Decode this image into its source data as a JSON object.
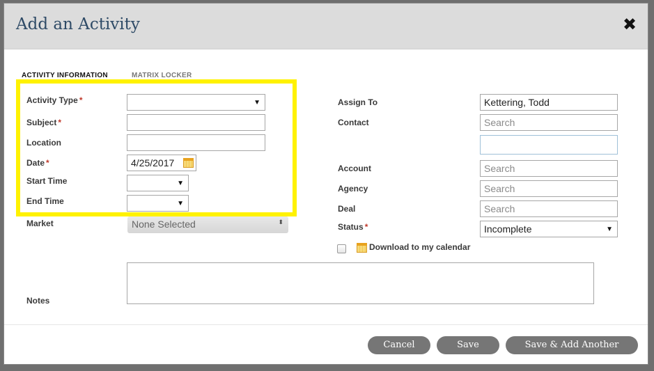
{
  "modal": {
    "title": "Add an Activity",
    "close_icon": "✖"
  },
  "tabs": [
    {
      "label": "ACTIVITY INFORMATION",
      "active": true
    },
    {
      "label": "MATRIX LOCKER",
      "active": false
    }
  ],
  "left_form": {
    "activity_type": {
      "label": "Activity Type",
      "required_mark": "*",
      "value": ""
    },
    "subject": {
      "label": "Subject",
      "required_mark": "*",
      "value": ""
    },
    "location": {
      "label": "Location",
      "value": ""
    },
    "date": {
      "label": "Date",
      "required_mark": "*",
      "value": "4/25/2017"
    },
    "start_time": {
      "label": "Start Time",
      "value": ""
    },
    "end_time": {
      "label": "End Time",
      "value": ""
    },
    "market": {
      "label": "Market",
      "value": "None Selected"
    }
  },
  "right_form": {
    "assign_to": {
      "label": "Assign To",
      "value": "Kettering, Todd"
    },
    "contact": {
      "label": "Contact",
      "placeholder": "Search"
    },
    "account": {
      "label": "Account",
      "placeholder": "Search"
    },
    "agency": {
      "label": "Agency",
      "placeholder": "Search"
    },
    "deal": {
      "label": "Deal",
      "placeholder": "Search"
    },
    "status": {
      "label": "Status",
      "required_mark": "*",
      "value": "Incomplete"
    },
    "download_label": "Download to my calendar"
  },
  "notes": {
    "label": "Notes",
    "value": ""
  },
  "footer": {
    "cancel_label": "Cancel",
    "save_label": "Save",
    "save_add_label": "Save & Add Another"
  },
  "icons": {
    "dropdown": "▼",
    "sort": "⬍",
    "calendar": "calendar-icon",
    "close": "close-icon"
  },
  "colors": {
    "highlight": "#fff200",
    "button": "#767676",
    "header": "#dcdcdc",
    "title": "#2e4a66",
    "required": "#c0392b"
  }
}
